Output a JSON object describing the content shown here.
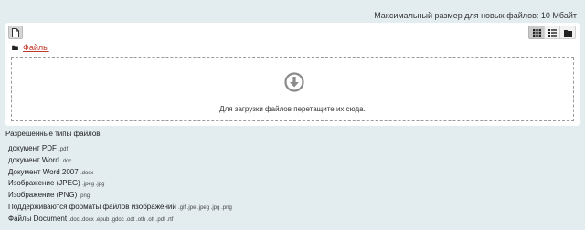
{
  "max_size": "Максимальный размер для новых файлов: 10 Мбайт",
  "filemanager": {
    "add_file_icon": "file-add-icon",
    "views": [
      {
        "name": "icons-view",
        "icon": "grid-icon",
        "active": true
      },
      {
        "name": "list-view",
        "icon": "list-icon",
        "active": false
      },
      {
        "name": "tree-view",
        "icon": "folder-icon",
        "active": false
      }
    ],
    "breadcrumb": {
      "root": "Файлы"
    },
    "dropzone": {
      "text": "Для загрузки файлов перетащите их сюда.",
      "icon": "download-arrow-icon"
    }
  },
  "allowed": {
    "title": "Разрешенные типы файлов",
    "types": [
      {
        "name": "документ PDF",
        "ext": ".pdf"
      },
      {
        "name": "документ Word",
        "ext": ".doc"
      },
      {
        "name": "Документ Word 2007",
        "ext": ".docx"
      },
      {
        "name": "Изображение (JPEG)",
        "ext": ".jpeg .jpg"
      },
      {
        "name": "Изображение (PNG)",
        "ext": ".png"
      },
      {
        "name": "Поддерживаются форматы файлов изображений",
        "ext": ".gif .jpe .jpeg .jpg .png"
      },
      {
        "name": "Файлы Document",
        "ext": ".doc .docx .epub .gdoc .odt .oth .ott .pdf .rtf"
      }
    ]
  },
  "colors": {
    "background": "#e3edf0",
    "link": "#c0392b",
    "panel": "#ffffff"
  }
}
